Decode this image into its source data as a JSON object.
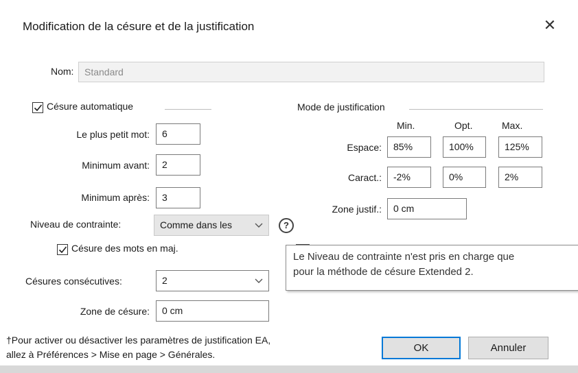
{
  "dialog": {
    "title": "Modification de la césure et de la justification",
    "close_glyph": "✕"
  },
  "name": {
    "label": "Nom:",
    "value": "Standard"
  },
  "hyphenation": {
    "auto_label": "Césure automatique",
    "auto_checked": true,
    "smallest_word_label": "Le plus petit mot:",
    "smallest_word_value": "6",
    "min_before_label": "Minimum avant:",
    "min_before_value": "2",
    "min_after_label": "Minimum après:",
    "min_after_value": "3",
    "constraint_label": "Niveau de contrainte:",
    "constraint_value": "Comme dans les",
    "help_glyph": "?",
    "caps_label": "Césure des mots en maj.",
    "caps_checked": true,
    "consecutive_label": "Césures consécutives:",
    "consecutive_value": "2",
    "zone_label": "Zone de césure:",
    "zone_value": "0 cm"
  },
  "justification": {
    "group_label": "Mode de justification",
    "col_min": "Min.",
    "col_opt": "Opt.",
    "col_max": "Max.",
    "space_label": "Espace:",
    "space_min": "85%",
    "space_opt": "100%",
    "space_max": "125%",
    "char_label": "Caract.:",
    "char_min": "-2%",
    "char_opt": "0%",
    "char_max": "2%",
    "zone_label": "Zone justif.:",
    "zone_value": "0 cm"
  },
  "tooltip": {
    "line1": "Le Niveau de contrainte n'est pris en charge que",
    "line2": "pour la méthode de césure Extended 2."
  },
  "footnote": {
    "line1": "†Pour activer ou désactiver les paramètres de justification EA,",
    "line2": "allez à Préférences > Mise en page > Générales."
  },
  "buttons": {
    "ok": "OK",
    "cancel": "Annuler"
  },
  "colors": {
    "accent": "#0078d7"
  }
}
